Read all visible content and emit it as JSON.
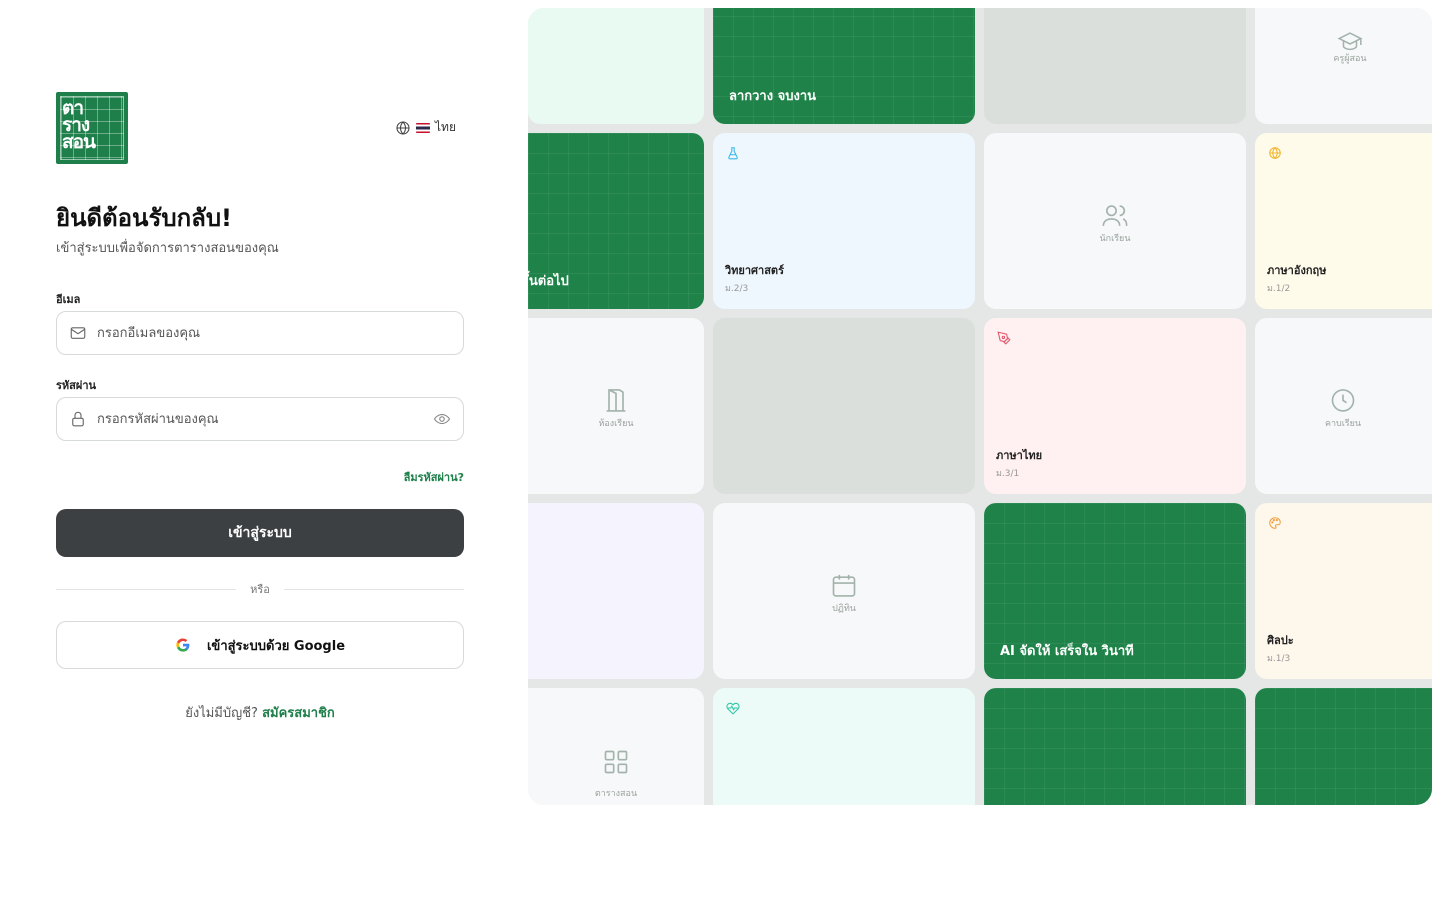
{
  "brand": {
    "logo_lines": [
      "ตา",
      "ราง",
      "สอน"
    ],
    "brand_color": "#1e7f4a"
  },
  "language": {
    "label": "ไทย",
    "icon": "globe-icon",
    "flag": "thai-flag"
  },
  "login": {
    "title": "ยินดีต้อนรับกลับ!",
    "subtitle": "เข้าสู่ระบบเพื่อจัดการตารางสอนของคุณ",
    "email_label": "อีเมล",
    "email_placeholder": "กรอกอีเมลของคุณ",
    "password_label": "รหัสผ่าน",
    "password_placeholder": "กรอกรหัสผ่านของคุณ",
    "forgot_password": "ลืมรหัสผ่าน?",
    "submit_label": "เข้าสู่ระบบ",
    "divider_text": "หรือ",
    "google_label": "เข้าสู่ระบบด้วย Google",
    "signup_prompt": "ยังไม่มีบัญชี?",
    "signup_link": "สมัครสมาชิก",
    "button_color": "#3d4043"
  },
  "mosaic": {
    "green_labels": {
      "drag_drop": "ลากวาง จบงาน",
      "next_step": "ขั้นต่อไป",
      "ai": "AI จัดให้ เสร็จใน วินาที"
    },
    "feature_tiles": {
      "teachers": {
        "label": "ครูผู้สอน",
        "icon": "graduation-cap-icon"
      },
      "students": {
        "label": "นักเรียน",
        "icon": "users-icon"
      },
      "rooms": {
        "label": "ห้องเรียน",
        "icon": "door-icon"
      },
      "periods": {
        "label": "คาบเรียน",
        "icon": "clock-icon"
      },
      "calendar": {
        "label": "ปฏิทิน",
        "icon": "calendar-icon"
      },
      "schedule": {
        "label": "ตารางสอน",
        "icon": "grid-icon"
      }
    },
    "subject_tiles": {
      "science": {
        "subject": "วิทยาศาสตร์",
        "class": "ม.2/3",
        "icon": "flask-icon",
        "color": "#38b6e6"
      },
      "english": {
        "subject": "ภาษาอังกฤษ",
        "class": "ม.1/2",
        "icon": "globe-icon",
        "color": "#f0b429"
      },
      "thai": {
        "subject": "ภาษาไทย",
        "class": "ม.3/1",
        "icon": "pen-icon",
        "color": "#e05468"
      },
      "art": {
        "subject": "ศิลปะ",
        "class": "ม.1/3",
        "icon": "palette-icon",
        "color": "#f0a040"
      },
      "health": {
        "icon": "heart-pulse-icon",
        "color": "#2fc6a8"
      }
    }
  }
}
